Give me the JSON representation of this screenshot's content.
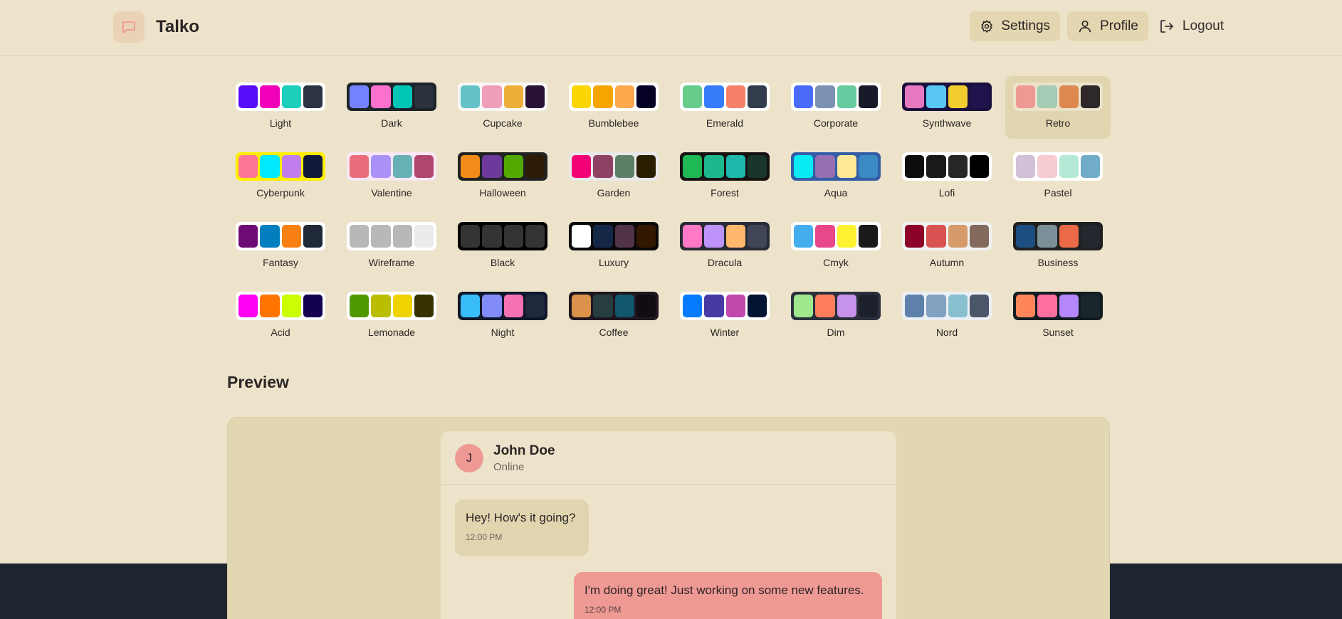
{
  "app": {
    "name": "Talko"
  },
  "nav": {
    "settings": "Settings",
    "profile": "Profile",
    "logout": "Logout"
  },
  "themes": [
    {
      "name": "Light",
      "colors": [
        "#570df8",
        "#f000b8",
        "#1ecebc",
        "#2b3440"
      ],
      "bg": "#ffffff"
    },
    {
      "name": "Dark",
      "colors": [
        "#7582ff",
        "#ff71cf",
        "#00c7b5",
        "#2a323c"
      ],
      "bg": "#1d232a"
    },
    {
      "name": "Cupcake",
      "colors": [
        "#65c3c8",
        "#ef9fbc",
        "#eeaf3a",
        "#291334"
      ],
      "bg": "#faf7f5"
    },
    {
      "name": "Bumblebee",
      "colors": [
        "#fbd600",
        "#f6a500",
        "#ffa94e",
        "#040125"
      ],
      "bg": "#ffffff"
    },
    {
      "name": "Emerald",
      "colors": [
        "#66cc8a",
        "#377cfb",
        "#f68067",
        "#333c4d"
      ],
      "bg": "#ffffff"
    },
    {
      "name": "Corporate",
      "colors": [
        "#4b6bfb",
        "#7b92b2",
        "#67cba0",
        "#181a2a"
      ],
      "bg": "#ffffff"
    },
    {
      "name": "Synthwave",
      "colors": [
        "#e779c1",
        "#58c7f3",
        "#f3cc30",
        "#20134e"
      ],
      "bg": "#1a103d"
    },
    {
      "name": "Retro",
      "colors": [
        "#ef9995",
        "#a4cbb4",
        "#dc8850",
        "#2e282a"
      ],
      "bg": "#ece3ca"
    },
    {
      "name": "Cyberpunk",
      "colors": [
        "#ff7598",
        "#00e9ff",
        "#c07eec",
        "#111a3b"
      ],
      "bg": "#ffee00"
    },
    {
      "name": "Valentine",
      "colors": [
        "#e96d7b",
        "#a991f7",
        "#66b1b3",
        "#af4670"
      ],
      "bg": "#fae7f4"
    },
    {
      "name": "Halloween",
      "colors": [
        "#f28c18",
        "#6d3a9c",
        "#51a800",
        "#2f1b05"
      ],
      "bg": "#212121"
    },
    {
      "name": "Garden",
      "colors": [
        "#f40076",
        "#8e4162",
        "#5c7f67",
        "#291e00"
      ],
      "bg": "#e9e7e7"
    },
    {
      "name": "Forest",
      "colors": [
        "#1eb854",
        "#1db88e",
        "#1db8ab",
        "#19362d"
      ],
      "bg": "#171212"
    },
    {
      "name": "Aqua",
      "colors": [
        "#09ecf3",
        "#966fb3",
        "#ffe999",
        "#3b8ac4"
      ],
      "bg": "#345da7"
    },
    {
      "name": "Lofi",
      "colors": [
        "#0d0d0d",
        "#1a1919",
        "#262626",
        "#000000"
      ],
      "bg": "#ffffff"
    },
    {
      "name": "Pastel",
      "colors": [
        "#d1c1d7",
        "#f6cbd1",
        "#b4e9d6",
        "#70acc7"
      ],
      "bg": "#ffffff"
    },
    {
      "name": "Fantasy",
      "colors": [
        "#6e0b75",
        "#007ebd",
        "#f98012",
        "#1f2937"
      ],
      "bg": "#ffffff"
    },
    {
      "name": "Wireframe",
      "colors": [
        "#b8b8b8",
        "#b8b8b8",
        "#b8b8b8",
        "#ebebeb"
      ],
      "bg": "#ffffff"
    },
    {
      "name": "Black",
      "colors": [
        "#343434",
        "#343434",
        "#343434",
        "#343434"
      ],
      "bg": "#000000"
    },
    {
      "name": "Luxury",
      "colors": [
        "#ffffff",
        "#152747",
        "#513448",
        "#331800"
      ],
      "bg": "#09090b"
    },
    {
      "name": "Dracula",
      "colors": [
        "#ff79c6",
        "#bd93f9",
        "#ffb86c",
        "#414558"
      ],
      "bg": "#282a36"
    },
    {
      "name": "Cmyk",
      "colors": [
        "#45aeee",
        "#e8488a",
        "#fff232",
        "#1a1a1a"
      ],
      "bg": "#ffffff"
    },
    {
      "name": "Autumn",
      "colors": [
        "#8c0327",
        "#d85251",
        "#d59b6a",
        "#826a5c"
      ],
      "bg": "#f1f1f1"
    },
    {
      "name": "Business",
      "colors": [
        "#1c4e80",
        "#7c909a",
        "#ea6947",
        "#23282e"
      ],
      "bg": "#202020"
    },
    {
      "name": "Acid",
      "colors": [
        "#ff00f4",
        "#ff7400",
        "#cbfd03",
        "#140152"
      ],
      "bg": "#fafafa"
    },
    {
      "name": "Lemonade",
      "colors": [
        "#519903",
        "#bbbd00",
        "#eed300",
        "#353100"
      ],
      "bg": "#ffffff"
    },
    {
      "name": "Night",
      "colors": [
        "#38bdf8",
        "#818cf8",
        "#f471b5",
        "#1e293b"
      ],
      "bg": "#0f172a"
    },
    {
      "name": "Coffee",
      "colors": [
        "#db924b",
        "#263e3f",
        "#10576d",
        "#120c12"
      ],
      "bg": "#20161f"
    },
    {
      "name": "Winter",
      "colors": [
        "#047aff",
        "#463aa2",
        "#c148ac",
        "#021431"
      ],
      "bg": "#ffffff"
    },
    {
      "name": "Dim",
      "colors": [
        "#9fe88d",
        "#ff7d5c",
        "#c792e9",
        "#1c212b"
      ],
      "bg": "#2a303c"
    },
    {
      "name": "Nord",
      "colors": [
        "#5e81ac",
        "#81a1c1",
        "#88c0d0",
        "#4c566a"
      ],
      "bg": "#eceff4"
    },
    {
      "name": "Sunset",
      "colors": [
        "#ff865b",
        "#fd6f9c",
        "#b387fa",
        "#1b262c"
      ],
      "bg": "#121c22"
    }
  ],
  "active_theme": "Retro",
  "preview": {
    "title": "Preview",
    "contact": {
      "initial": "J",
      "name": "John Doe",
      "status": "Online"
    },
    "messages": [
      {
        "text": "Hey! How's it going?",
        "time": "12:00 PM",
        "sent": false
      },
      {
        "text": "I'm doing great! Just working on some new features.",
        "time": "12:00 PM",
        "sent": true
      }
    ]
  },
  "colors": {
    "primary": "#ef9995",
    "base": "#ece3ca",
    "base_alt": "#e1d5b0",
    "text": "#2b2526"
  }
}
